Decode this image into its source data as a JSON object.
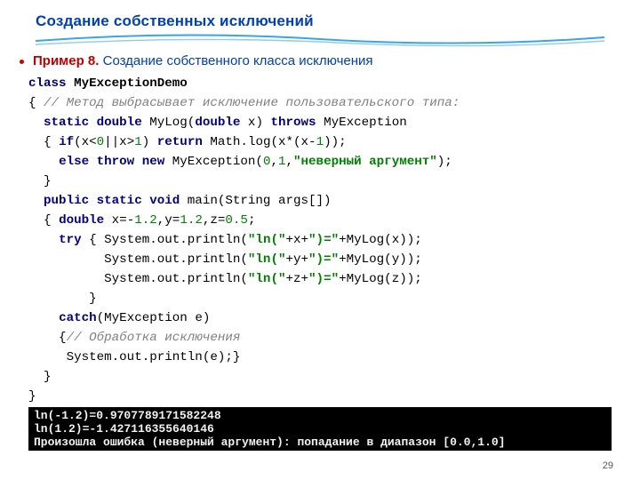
{
  "title": "Создание собственных исключений",
  "subtitle": {
    "label": "Пример 8.",
    "text": "Создание собственного класса исключения"
  },
  "code": {
    "l1a": "class",
    "l1b": " MyExceptionDemo",
    "l2a": "{ ",
    "l2b": "// Метод выбрасывает исключение пользовательского типа:",
    "l3a": "  ",
    "l3b": "static double",
    "l3c": " MyLog(",
    "l3d": "double",
    "l3e": " x) ",
    "l3f": "throws",
    "l3g": " MyException",
    "l4a": "  { ",
    "l4b": "if",
    "l4c": "(x<",
    "l4d": "0",
    "l4e": "||x>",
    "l4f": "1",
    "l4g": ") ",
    "l4h": "return",
    "l4i": " Math.log(x*(x-",
    "l4j": "1",
    "l4k": "));",
    "l5a": "    ",
    "l5b": "else throw new",
    "l5c": " MyException(",
    "l5d": "0",
    "l5e": ",",
    "l5f": "1",
    "l5g": ",",
    "l5h": "\"неверный аргумент\"",
    "l5i": ");",
    "l6": "  }",
    "l7a": "  ",
    "l7b": "public static void",
    "l7c": " main(String args[])",
    "l8a": "  { ",
    "l8b": "double",
    "l8c": " x=-",
    "l8d": "1.2",
    "l8e": ",y=",
    "l8f": "1.2",
    "l8g": ",z=",
    "l8h": "0.5",
    "l8i": ";",
    "l9a": "    ",
    "l9b": "try",
    "l9c": " { System.out.println(",
    "l9d": "\"ln(\"",
    "l9e": "+x+",
    "l9f": "\")=\"",
    "l9g": "+MyLog(x));",
    "l10a": "          System.out.println(",
    "l10b": "\"ln(\"",
    "l10c": "+y+",
    "l10d": "\")=\"",
    "l10e": "+MyLog(y));",
    "l11a": "          System.out.println(",
    "l11b": "\"ln(\"",
    "l11c": "+z+",
    "l11d": "\")=\"",
    "l11e": "+MyLog(z));",
    "l12": "        }",
    "l13a": "    ",
    "l13b": "catch",
    "l13c": "(MyException e)",
    "l14a": "    {",
    "l14b": "// Обработка исключения",
    "l15": "     System.out.println(e);}",
    "l16": "  }",
    "l17": "}"
  },
  "console": {
    "l1": "ln(-1.2)=0.9707789171582248",
    "l2": "ln(1.2)=-1.427116355640146",
    "l3": "Произошла ошибка (неверный аргумент): попадание в диапазон [0.0,1.0]"
  },
  "pagenum": "29"
}
